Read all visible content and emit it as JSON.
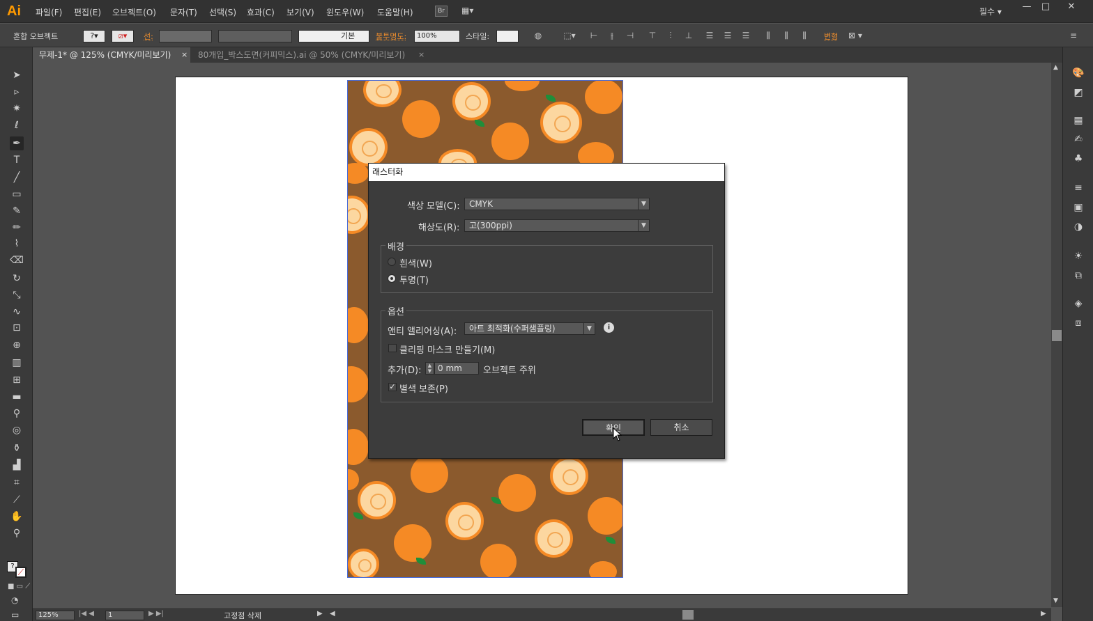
{
  "app": {
    "logo": "Ai",
    "workspace": "필수 ▾"
  },
  "menu": [
    "파일(F)",
    "편집(E)",
    "오브젝트(O)",
    "문자(T)",
    "선택(S)",
    "효과(C)",
    "보기(V)",
    "윈도우(W)",
    "도움말(H)"
  ],
  "menu_extra": {
    "bridge": "Br"
  },
  "window_buttons": {
    "minimize": "—",
    "maximize": "□",
    "close": "✕"
  },
  "control": {
    "selection": "혼합 오브젝트",
    "stroke_label": "선:",
    "stroke_style": "기본",
    "opacity_label": "불투명도:",
    "opacity_value": "100%",
    "style_label": "스타일:",
    "transform_label": "변형"
  },
  "tabs": [
    {
      "label": "무제-1* @ 125% (CMYK/미리보기)",
      "close": "×",
      "active": true
    },
    {
      "label": "80개입_박스도면(커피믹스).ai @ 50% (CMYK/미리보기)",
      "close": "×",
      "active": false
    }
  ],
  "status": {
    "zoom": "125%",
    "page": "1",
    "info": "고정점 삭제"
  },
  "dialog": {
    "title": "래스터화",
    "color_model_label": "색상 모델(C):",
    "color_model_value": "CMYK",
    "resolution_label": "해상도(R):",
    "resolution_value": "고(300ppi)",
    "background_group": "배경",
    "bg_white": "흰색(W)",
    "bg_transparent": "투명(T)",
    "background_selected": "transparent",
    "options_group": "옵션",
    "antialias_label": "앤티 앨리어싱(A):",
    "antialias_value": "아트 최적화(수퍼샘플링)",
    "clip_mask_label": "클리핑 마스크 만들기(M)",
    "clip_mask_checked": false,
    "add_label": "추가(D):",
    "add_value": "0 mm",
    "add_suffix": "오브젝트 주위",
    "spot_label": "별색 보존(P)",
    "spot_checked": true,
    "ok": "확인",
    "cancel": "취소"
  },
  "colors": {
    "accent": "#ff9a00",
    "pattern_bg": "#8b5a2d",
    "orange": "#f58a25",
    "slice": "#fcd7a0",
    "leaf": "#1f8e3a",
    "selection": "#4a6bd6"
  }
}
